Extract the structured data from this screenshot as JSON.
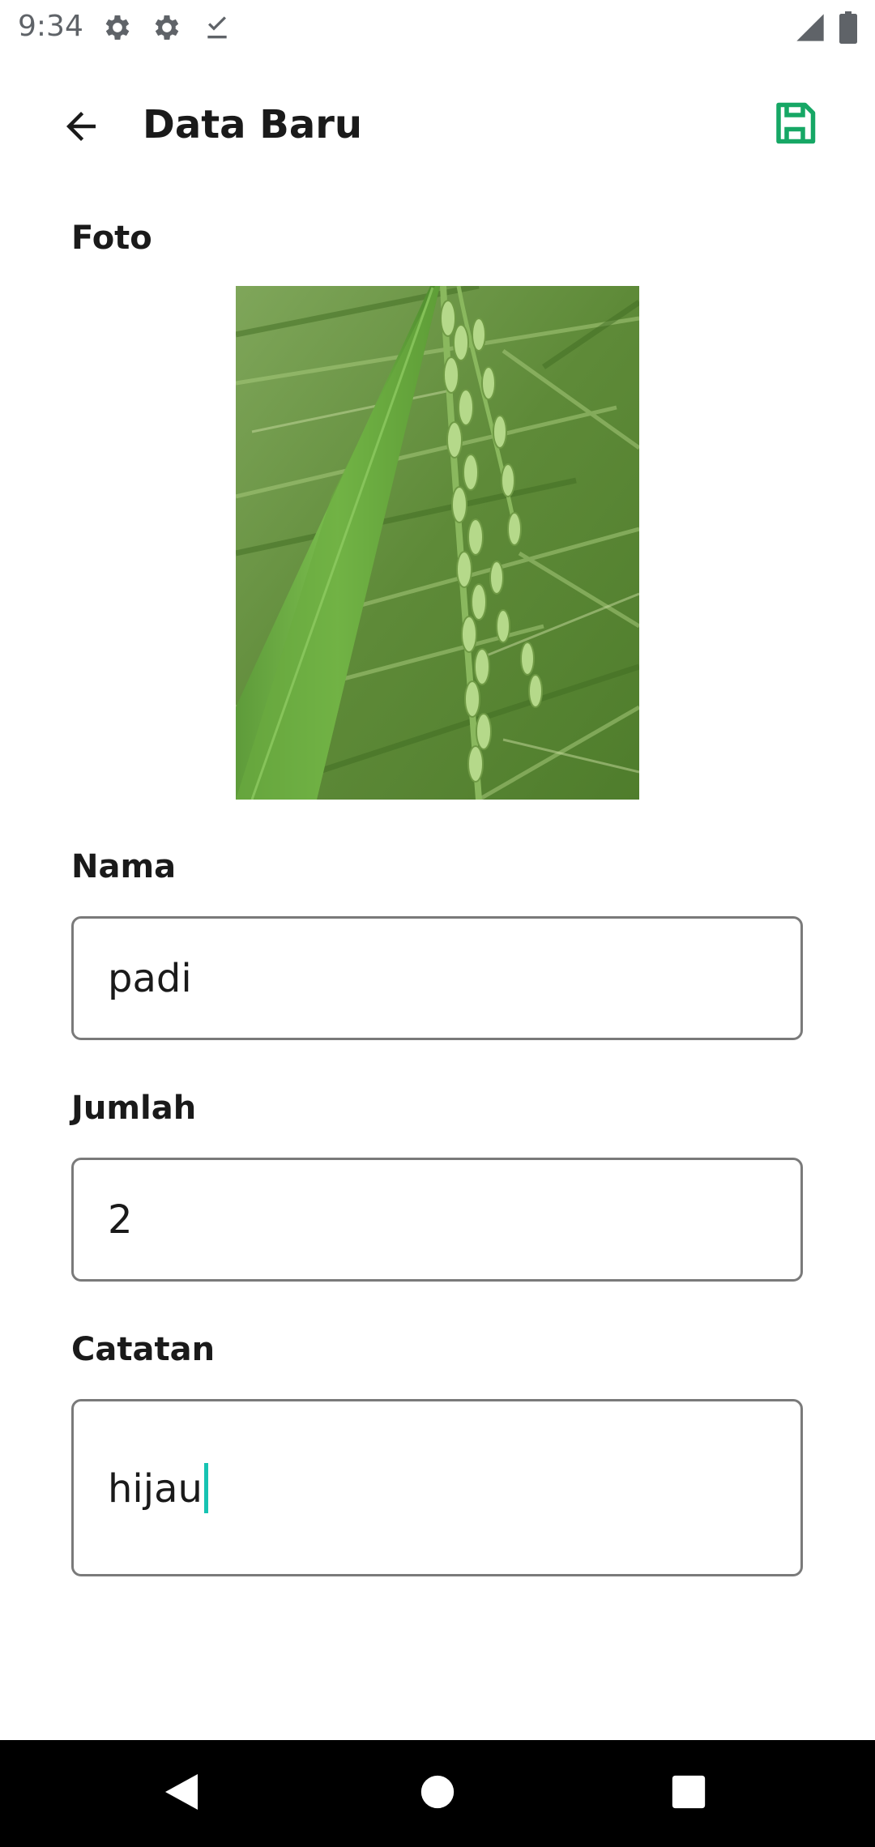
{
  "status_bar": {
    "time": "9:34",
    "icons": [
      "gear-icon",
      "gear-icon",
      "download-done-icon"
    ],
    "right_icons": [
      "cell-signal-icon",
      "battery-icon"
    ]
  },
  "toolbar": {
    "title": "Data Baru",
    "back_icon": "arrow-back-icon",
    "save_icon": "save-icon",
    "accent_color": "#16a765"
  },
  "form": {
    "photo_label": "Foto",
    "photo_icon": "rice-plant-photo",
    "name_label": "Nama",
    "name_value": "padi",
    "quantity_label": "Jumlah",
    "quantity_value": "2",
    "notes_label": "Catatan",
    "notes_value": "hijau"
  },
  "nav_bar": {
    "icons": [
      "nav-back-icon",
      "nav-home-icon",
      "nav-recents-icon"
    ]
  }
}
